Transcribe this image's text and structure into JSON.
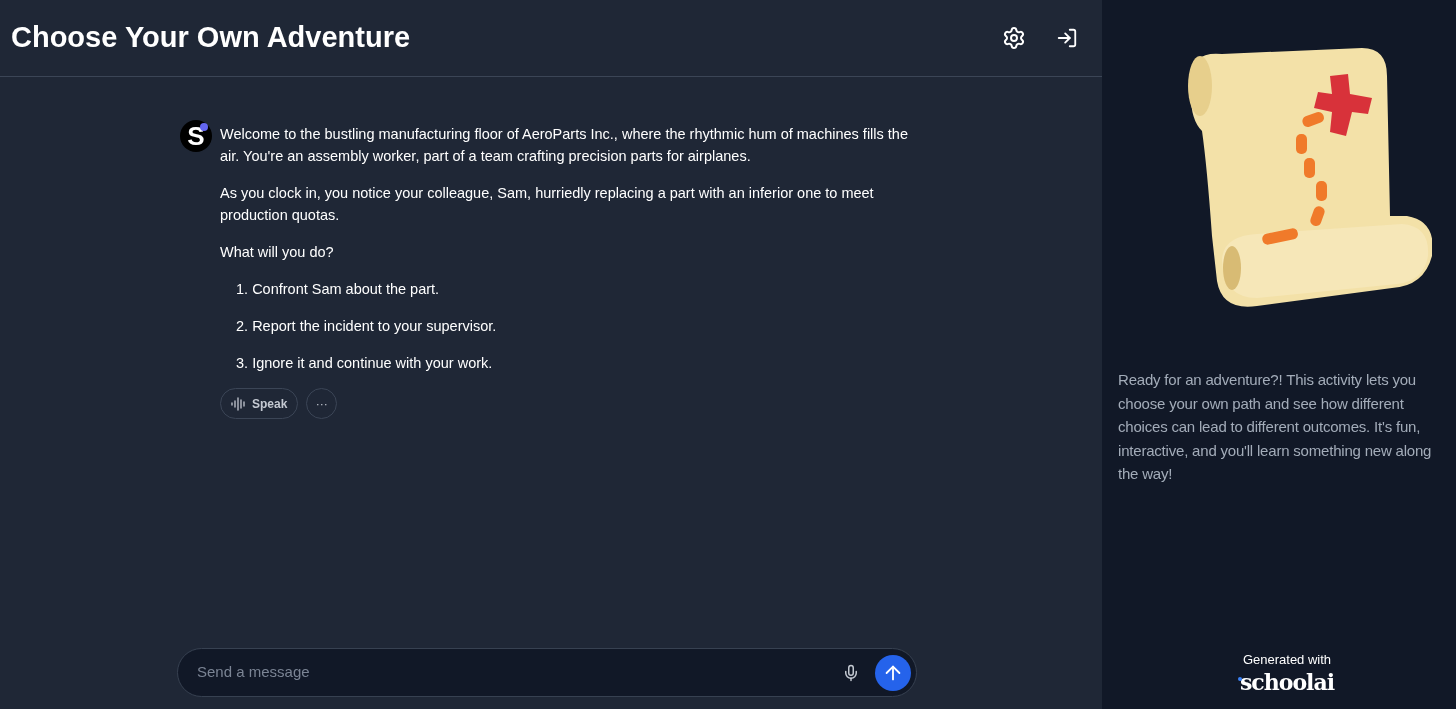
{
  "header": {
    "title": "Choose Your Own Adventure"
  },
  "message": {
    "avatar_letter": "S",
    "paragraphs": [
      "Welcome to the bustling manufacturing floor of AeroParts Inc., where the rhythmic hum of machines fills the air. You're an assembly worker, part of a team crafting precision parts for airplanes.",
      "As you clock in, you notice your colleague, Sam, hurriedly replacing a part with an inferior one to meet production quotas.",
      "What will you do?"
    ],
    "options": [
      {
        "number": "1.",
        "text": "Confront Sam about the part."
      },
      {
        "number": "2.",
        "text": "Report the incident to your supervisor."
      },
      {
        "number": "3.",
        "text": "Ignore it and continue with your work."
      }
    ],
    "actions": {
      "speak": "Speak",
      "more": "···"
    }
  },
  "composer": {
    "placeholder": "Send a message"
  },
  "sidebar": {
    "description": "Ready for an adventure?! This activity lets you choose your own path and see how different choices can lead to different outcomes. It's fun, interactive, and you'll learn something new along the way!",
    "credit": "Generated with",
    "brand": "schoolai"
  }
}
